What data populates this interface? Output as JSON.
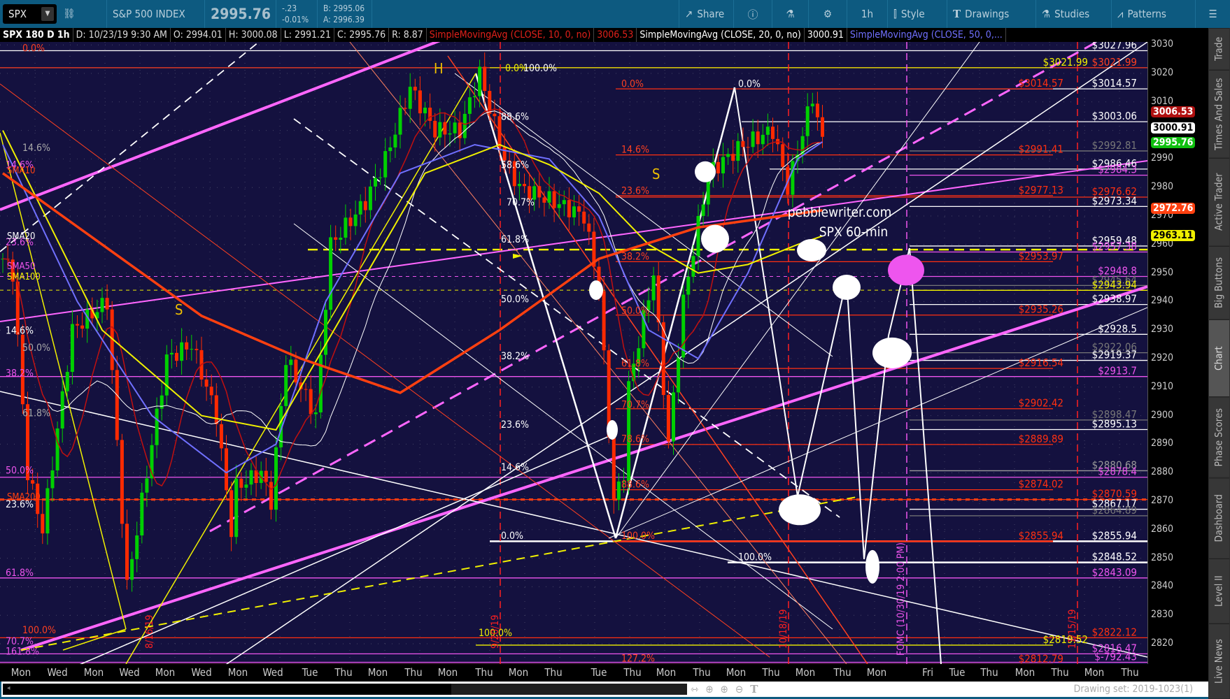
{
  "toolbar": {
    "symbol": "SPX",
    "name": "S&P 500 INDEX",
    "last": "2995.76",
    "change": "-.23",
    "change_pct": "-0.01%",
    "bid": "B: 2995.06",
    "ask": "A: 2996.39",
    "buttons": {
      "share": "Share",
      "timeframe": "1h",
      "style": "Style",
      "drawings": "Drawings",
      "studies": "Studies",
      "patterns": "Patterns"
    }
  },
  "header": {
    "title": "SPX 180 D 1h",
    "date": "D: 10/23/19 9:30 AM",
    "open": "O: 2994.01",
    "high": "H: 3000.08",
    "low": "L: 2991.21",
    "close": "C: 2995.76",
    "range": "R: 8.87",
    "sma10": "SimpleMovingAvg (CLOSE, 10, 0, no)",
    "sma10_val": "3006.53",
    "sma20": "SimpleMovingAvg (CLOSE, 20, 0, no)",
    "sma20_val": "3000.91",
    "sma50": "SimpleMovingAvg (CLOSE, 50, 0,..."
  },
  "price_axis": {
    "ticks": [
      3030,
      3020,
      3010,
      3000,
      2990,
      2980,
      2970,
      2960,
      2950,
      2940,
      2930,
      2920,
      2910,
      2900,
      2890,
      2880,
      2870,
      2860,
      2850,
      2840,
      2830,
      2820
    ],
    "badges": [
      {
        "value": "3006.53",
        "price": 3006.53,
        "bg": "#b01010",
        "fg": "#fff"
      },
      {
        "value": "3000.91",
        "price": 3000.91,
        "bg": "#ffffff",
        "fg": "#000"
      },
      {
        "value": "2995.76",
        "price": 2995.76,
        "bg": "#10c010",
        "fg": "#fff"
      },
      {
        "value": "2972.76",
        "price": 2972.76,
        "bg": "#ff4010",
        "fg": "#fff"
      },
      {
        "value": "2963.11",
        "price": 2963.11,
        "bg": "#f0f000",
        "fg": "#000"
      }
    ]
  },
  "x_axis": [
    "Mon",
    "Wed",
    "Mon",
    "Wed",
    "Mon",
    "Wed",
    "Mon",
    "Wed",
    "Tue",
    "Thu",
    "Mon",
    "Thu",
    "Mon",
    "Thu",
    "Mon",
    "Thu",
    "Tue",
    "Thu",
    "Mon",
    "Thu",
    "Mon",
    "Thu",
    "Mon",
    "Thu",
    "Mon",
    "Fri",
    "Tue",
    "Thu",
    "Mon",
    "Thu",
    "Mon",
    "Thu"
  ],
  "status": {
    "drawing_set": "Drawing set: 2019-1023(1)"
  },
  "sidebar_tabs": [
    "Trade",
    "Times And Sales",
    "Active Trader",
    "Big Buttons",
    "Chart",
    "Phase Scores",
    "Dashboard",
    "Level II",
    "Live News"
  ],
  "chart_data": {
    "type": "candlestick",
    "symbol": "SPX",
    "interval": "1h",
    "ylim": [
      2815,
      3032
    ],
    "closes": [
      [
        0,
        2955
      ],
      [
        2,
        2950
      ],
      [
        5,
        2880
      ],
      [
        8,
        2860
      ],
      [
        14,
        2930
      ],
      [
        21,
        2940
      ],
      [
        25,
        2840
      ],
      [
        28,
        2870
      ],
      [
        33,
        2920
      ],
      [
        38,
        2925
      ],
      [
        43,
        2900
      ],
      [
        46,
        2860
      ],
      [
        47,
        2875
      ],
      [
        52,
        2880
      ],
      [
        54,
        2870
      ],
      [
        57,
        2920
      ],
      [
        63,
        2900
      ],
      [
        66,
        2960
      ],
      [
        73,
        2975
      ],
      [
        77,
        2990
      ],
      [
        82,
        3015
      ],
      [
        87,
        3000
      ],
      [
        92,
        3000
      ],
      [
        96,
        3020
      ],
      [
        101,
        2990
      ],
      [
        104,
        2980
      ],
      [
        111,
        2975
      ],
      [
        117,
        2970
      ],
      [
        120,
        2945
      ],
      [
        123,
        2870
      ],
      [
        125,
        2880
      ],
      [
        126,
        2910
      ],
      [
        131,
        2950
      ],
      [
        134,
        2890
      ],
      [
        137,
        2940
      ],
      [
        142,
        2985
      ],
      [
        149,
        2995
      ],
      [
        155,
        3000
      ],
      [
        158,
        2980
      ],
      [
        163,
        3012
      ],
      [
        165,
        2996
      ]
    ],
    "sma200": [
      [
        0,
        2985
      ],
      [
        20,
        2960
      ],
      [
        40,
        2935
      ],
      [
        60,
        2920
      ],
      [
        80,
        2908
      ],
      [
        100,
        2930
      ],
      [
        120,
        2955
      ],
      [
        140,
        2966
      ],
      [
        165,
        2972
      ]
    ],
    "sma100": [
      [
        0,
        3000
      ],
      [
        20,
        2930
      ],
      [
        40,
        2900
      ],
      [
        55,
        2895
      ],
      [
        70,
        2940
      ],
      [
        85,
        2985
      ],
      [
        100,
        2995
      ],
      [
        110,
        2988
      ],
      [
        120,
        2978
      ],
      [
        130,
        2960
      ],
      [
        140,
        2950
      ],
      [
        150,
        2953
      ],
      [
        160,
        2960
      ],
      [
        165,
        2963
      ]
    ],
    "sma50": [
      [
        0,
        2995
      ],
      [
        15,
        2940
      ],
      [
        30,
        2900
      ],
      [
        45,
        2880
      ],
      [
        55,
        2890
      ],
      [
        65,
        2940
      ],
      [
        80,
        2985
      ],
      [
        95,
        2995
      ],
      [
        110,
        2990
      ],
      [
        120,
        2970
      ],
      [
        130,
        2930
      ],
      [
        140,
        2920
      ],
      [
        150,
        2950
      ],
      [
        160,
        2990
      ],
      [
        165,
        2996
      ]
    ],
    "level_labels": [
      {
        "text": "$3027.96",
        "price": 3027.96,
        "color": "#ffffff"
      },
      {
        "text": "$3021.99",
        "price": 3021.99,
        "color": "#ff4020"
      },
      {
        "text": "$3021.99",
        "price": 3021.99,
        "color": "#f0f000",
        "alt": true
      },
      {
        "text": "$3014.57",
        "price": 3014.57,
        "color": "#ffffff"
      },
      {
        "text": "$3014.57",
        "price": 3014.57,
        "color": "#ff3010",
        "alt": true
      },
      {
        "text": "$3003.06",
        "price": 3003.06,
        "color": "#ffffff"
      },
      {
        "text": "$2992.81",
        "price": 2992.81,
        "color": "#777777"
      },
      {
        "text": "$2991.41",
        "price": 2991.41,
        "color": "#ff3010",
        "alt": true
      },
      {
        "text": "$2986.46",
        "price": 2986.46,
        "color": "#ffffff"
      },
      {
        "text": "$2984.3",
        "price": 2984.3,
        "color": "#ee55ee"
      },
      {
        "text": "$2977.13",
        "price": 2977.13,
        "color": "#ff3010",
        "alt": true
      },
      {
        "text": "$2976.62",
        "price": 2976.62,
        "color": "#ff3010"
      },
      {
        "text": "$2973.34",
        "price": 2973.34,
        "color": "#ffffff"
      },
      {
        "text": "$2959.48",
        "price": 2959.48,
        "color": "#ffffff"
      },
      {
        "text": "$2957.38",
        "price": 2957.38,
        "color": "#ee55ee"
      },
      {
        "text": "$2953.97",
        "price": 2953.97,
        "color": "#ff3010",
        "alt": true
      },
      {
        "text": "$2948.8",
        "price": 2948.8,
        "color": "#ee55ee"
      },
      {
        "text": "$2945.64",
        "price": 2945.64,
        "color": "#777777"
      },
      {
        "text": "$2943.94",
        "price": 2943.94,
        "color": "#f0f000"
      },
      {
        "text": "$2938.97",
        "price": 2938.97,
        "color": "#ffffff"
      },
      {
        "text": "$2935.26",
        "price": 2935.26,
        "color": "#ff3010",
        "alt": true
      },
      {
        "text": "$2928.5",
        "price": 2928.5,
        "color": "#ffffff"
      },
      {
        "text": "$2922.06",
        "price": 2922.06,
        "color": "#777777"
      },
      {
        "text": "$2919.37",
        "price": 2919.37,
        "color": "#ffffff"
      },
      {
        "text": "$2916.54",
        "price": 2916.54,
        "color": "#ff3010",
        "alt": true
      },
      {
        "text": "$2913.7",
        "price": 2913.7,
        "color": "#ee55ee"
      },
      {
        "text": "$2902.42",
        "price": 2902.42,
        "color": "#ff3010",
        "alt": true
      },
      {
        "text": "$2898.47",
        "price": 2898.47,
        "color": "#777777"
      },
      {
        "text": "$2895.13",
        "price": 2895.13,
        "color": "#ffffff"
      },
      {
        "text": "$2889.89",
        "price": 2889.89,
        "color": "#ff3010",
        "alt": true
      },
      {
        "text": "$2880.68",
        "price": 2880.68,
        "color": "#999999"
      },
      {
        "text": "$2878.4",
        "price": 2878.4,
        "color": "#ee55ee"
      },
      {
        "text": "$2874.02",
        "price": 2874.02,
        "color": "#ff3010",
        "alt": true
      },
      {
        "text": "$2870.59",
        "price": 2870.59,
        "color": "#ff3010"
      },
      {
        "text": "$2867.17",
        "price": 2867.17,
        "color": "#ffffff"
      },
      {
        "text": "$2864.89",
        "price": 2864.89,
        "color": "#777777"
      },
      {
        "text": "$2855.94",
        "price": 2855.94,
        "color": "#ffffff"
      },
      {
        "text": "$2855.94",
        "price": 2855.94,
        "color": "#ff3010",
        "alt": true
      },
      {
        "text": "$2848.52",
        "price": 2848.52,
        "color": "#ffffff"
      },
      {
        "text": "$2843.09",
        "price": 2843.09,
        "color": "#ee55ee"
      },
      {
        "text": "$2822.12",
        "price": 2822.12,
        "color": "#ff3010"
      },
      {
        "text": "$2819.52",
        "price": 2819.52,
        "color": "#f0f000",
        "alt": true
      },
      {
        "text": "$2816.47",
        "price": 2816.47,
        "color": "#ee55ee"
      },
      {
        "text": "$2812.79",
        "price": 2812.79,
        "color": "#ff3010",
        "alt": true
      },
      {
        "text": "$-792.43",
        "price": 2813.5,
        "color": "#ee55ee"
      }
    ],
    "fib_labels": [
      {
        "text": "0.0%",
        "price": 3027,
        "color": "#ff4020",
        "x": "left"
      },
      {
        "text": "14.6%",
        "price": 2992,
        "color": "#aaaaaa"
      },
      {
        "text": "14.6%",
        "price": 2986,
        "color": "#ee55ee"
      },
      {
        "text": "23.6%",
        "price": 2959,
        "color": "#ee55ee"
      },
      {
        "text": "14.6%",
        "price": 2928,
        "color": "#ffffff"
      },
      {
        "text": "50.0%",
        "price": 2922,
        "color": "#aaaaaa"
      },
      {
        "text": "38.2%",
        "price": 2913,
        "color": "#ee55ee"
      },
      {
        "text": "61.8%",
        "price": 2899,
        "color": "#aaaaaa"
      },
      {
        "text": "50.0%",
        "price": 2879,
        "color": "#ee55ee"
      },
      {
        "text": "23.6%",
        "price": 2867,
        "color": "#ffffff"
      },
      {
        "text": "61.8%",
        "price": 2843,
        "color": "#ee55ee"
      },
      {
        "text": "100.0%",
        "price": 2823,
        "color": "#ff4020"
      },
      {
        "text": "70.7%",
        "price": 2819,
        "color": "#ee55ee"
      },
      {
        "text": "161.8%",
        "price": 2815.5,
        "color": "#ee55ee"
      },
      {
        "text": "0.0%",
        "price": 3020,
        "color": "#f0f000"
      },
      {
        "text": "100.0%",
        "price": 3020,
        "color": "#ffffff"
      },
      {
        "text": "88.6%",
        "price": 3003,
        "color": "#ffffff"
      },
      {
        "text": "58.6%",
        "price": 2986,
        "color": "#ffffff"
      },
      {
        "text": "70.7%",
        "price": 2973,
        "color": "#ffffff"
      },
      {
        "text": "61.8%",
        "price": 2960,
        "color": "#ffffff"
      },
      {
        "text": "50.0%",
        "price": 2939,
        "color": "#ffffff"
      },
      {
        "text": "38.2%",
        "price": 2919,
        "color": "#ffffff"
      },
      {
        "text": "23.6%",
        "price": 2895,
        "color": "#ffffff"
      },
      {
        "text": "14.6%",
        "price": 2880,
        "color": "#ffffff"
      },
      {
        "text": "0.0%",
        "price": 2856,
        "color": "#ffffff"
      },
      {
        "text": "100.0%",
        "price": 2822,
        "color": "#f0f000"
      },
      {
        "text": "0.0%",
        "price": 3014.5,
        "color": "#ff4020"
      },
      {
        "text": "14.6%",
        "price": 2991.5,
        "color": "#ff4020"
      },
      {
        "text": "23.6%",
        "price": 2977,
        "color": "#ff4020"
      },
      {
        "text": "38.2%",
        "price": 2954,
        "color": "#ff4020"
      },
      {
        "text": "50.0%",
        "price": 2935,
        "color": "#ff4020"
      },
      {
        "text": "61.8%",
        "price": 2916.5,
        "color": "#ff4020"
      },
      {
        "text": "70.7%",
        "price": 2902,
        "color": "#ff4020"
      },
      {
        "text": "78.6%",
        "price": 2890,
        "color": "#ff4020"
      },
      {
        "text": "88.6%",
        "price": 2874,
        "color": "#ff4020"
      },
      {
        "text": "100.0%",
        "price": 2856,
        "color": "#ff4020"
      },
      {
        "text": "127.2%",
        "price": 2813,
        "color": "#ff4020"
      },
      {
        "text": "0.0%",
        "price": 3014.5,
        "color": "#ffffff"
      },
      {
        "text": "100.0%",
        "price": 2848.5,
        "color": "#ffffff"
      }
    ],
    "annotations": {
      "h": "H",
      "s1": "S",
      "s2": "S",
      "site": "pebblewriter.com",
      "subtitle": "SPX 60-min",
      "sma10": "SMA10",
      "sma20": "SMA20",
      "sma50": "SMA50",
      "sma100": "SMA100",
      "sma200": "SMA200",
      "date1": "8/16/19",
      "date2": "9/20/19",
      "date3": "10/18/19",
      "fomc": "FOMC (10/30/19 2:00 PM)",
      "date4": "11/15/19"
    }
  }
}
